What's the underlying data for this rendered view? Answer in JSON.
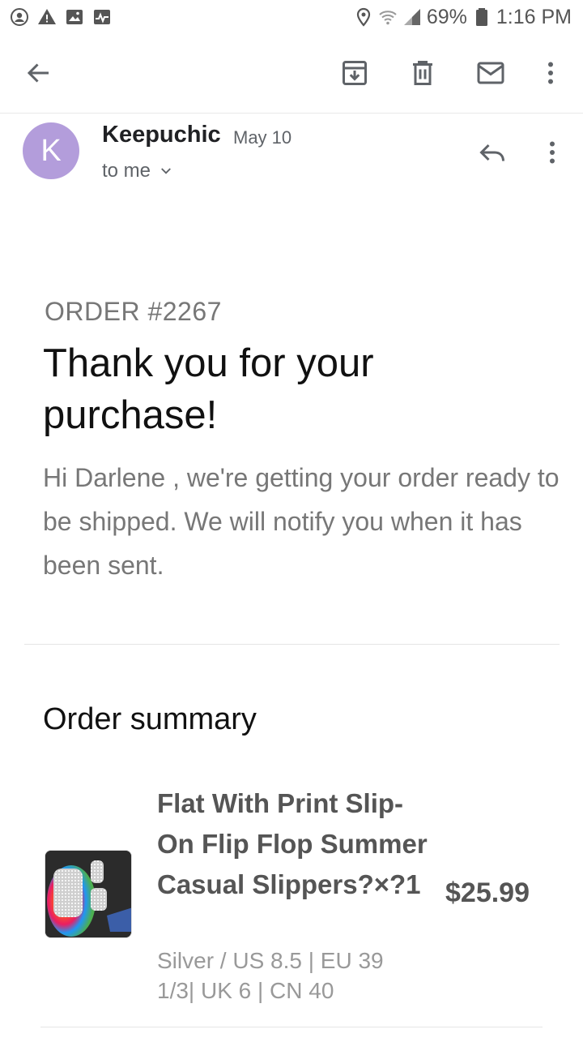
{
  "status_bar": {
    "battery": "69%",
    "time": "1:16 PM",
    "icons": [
      "account-circle-icon",
      "warning-icon",
      "image-icon",
      "activity-icon",
      "location-icon",
      "wifi-icon",
      "signal-icon",
      "battery-icon"
    ]
  },
  "toolbar": {
    "icons": [
      "back-arrow-icon",
      "archive-icon",
      "delete-icon",
      "mark-unread-icon",
      "more-vert-icon"
    ]
  },
  "email": {
    "avatar_letter": "K",
    "avatar_color": "#b39ddb",
    "sender": "Keepuchic",
    "date": "May 10",
    "to": "to me"
  },
  "body": {
    "order_number": "ORDER #2267",
    "heading": "Thank you for your purchase!",
    "intro": "Hi Darlene , we're getting your order ready to be shipped. We will notify you when it has been sent.",
    "summary_title": "Order summary"
  },
  "items": [
    {
      "name": "Flat With Print Slip-On Flip Flop Summer Casual Slippers?×?1",
      "variant": "Silver / US 8.5 | EU 39 1/3| UK 6 | CN 40",
      "price": "$25.99"
    }
  ]
}
